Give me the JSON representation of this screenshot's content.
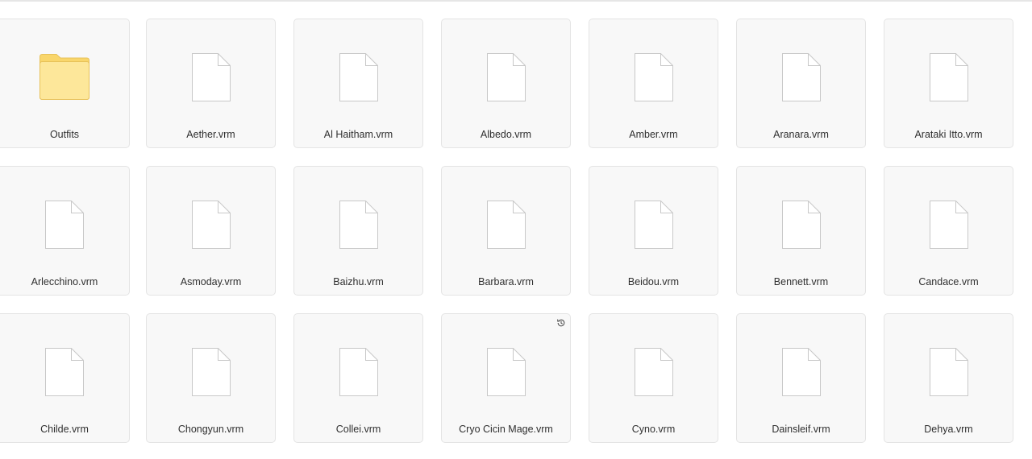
{
  "files": [
    {
      "name": "Outfits",
      "type": "folder"
    },
    {
      "name": "Aether.vrm",
      "type": "file"
    },
    {
      "name": "Al Haitham.vrm",
      "type": "file"
    },
    {
      "name": "Albedo.vrm",
      "type": "file"
    },
    {
      "name": "Amber.vrm",
      "type": "file"
    },
    {
      "name": "Aranara.vrm",
      "type": "file"
    },
    {
      "name": "Arataki Itto.vrm",
      "type": "file"
    },
    {
      "name": "Arlecchino.vrm",
      "type": "file"
    },
    {
      "name": "Asmoday.vrm",
      "type": "file"
    },
    {
      "name": "Baizhu.vrm",
      "type": "file"
    },
    {
      "name": "Barbara.vrm",
      "type": "file"
    },
    {
      "name": "Beidou.vrm",
      "type": "file"
    },
    {
      "name": "Bennett.vrm",
      "type": "file"
    },
    {
      "name": "Candace.vrm",
      "type": "file"
    },
    {
      "name": "Childe.vrm",
      "type": "file"
    },
    {
      "name": "Chongyun.vrm",
      "type": "file"
    },
    {
      "name": "Collei.vrm",
      "type": "file"
    },
    {
      "name": "Cryo Cicin Mage.vrm",
      "type": "file",
      "badge": "history-icon"
    },
    {
      "name": "Cyno.vrm",
      "type": "file"
    },
    {
      "name": "Dainsleif.vrm",
      "type": "file"
    },
    {
      "name": "Dehya.vrm",
      "type": "file"
    }
  ],
  "colors": {
    "folder_fill": "#fde79a",
    "folder_tab": "#f9d66b",
    "folder_stroke": "#e8c25a",
    "file_stroke": "#c8c8c8",
    "tile_bg": "#f8f8f8",
    "tile_border": "#e4e4e4"
  }
}
